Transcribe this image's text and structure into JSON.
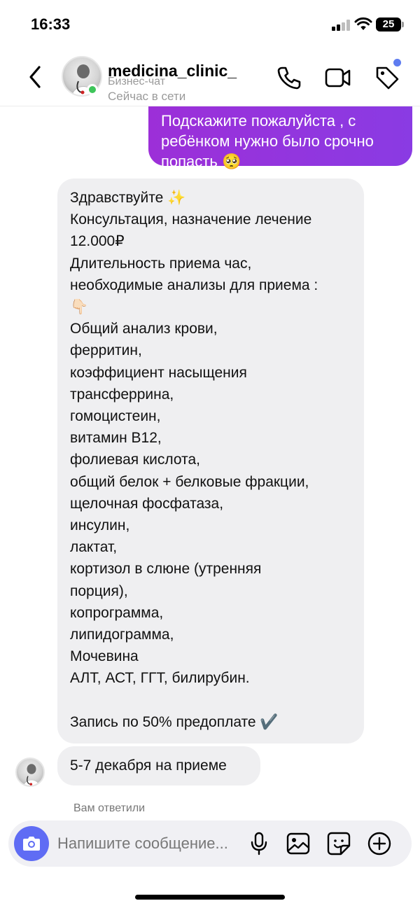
{
  "status_bar": {
    "time": "16:33",
    "battery": "25"
  },
  "header": {
    "name": "medicina_clinic_",
    "subtitle": "Бизнес-чат",
    "status": "Сейчас в сети"
  },
  "messages": {
    "outgoing_partial": "Подскажите пожалуйста , с\nребёнком нужно было срочно\nпопасть 🥺",
    "incoming_main": "Здравствуйте ✨\nКонсультация, назначение лечение\n12.000₽\nДлительность приема час,\nнеобходимые анализы для приема :\n👇🏻\nОбщий анализ крови,\nферритин,\nкоэффициент насыщения\nтрансферрина,\nгомоцистеин,\nвитамин B12,\nфолиевая кислота,\nобщий белок + белковые фракции,\nщелочная фосфатаза,\nинсулин,\nлактат,\nкортизол в слюне (утренняя\nпорция),\nкопрограмма,\nлипидограмма,\nМочевина\nАЛТ, АСТ, ГГТ, билирубин.\n\nЗапись по 50% предоплате ✔️",
    "incoming_short": "5-7 декабря на приеме",
    "replied_note": "Вам ответили"
  },
  "composer": {
    "placeholder": "Напишите сообщение..."
  },
  "colors": {
    "outgoing_bubble": "#9c2fd8",
    "incoming_bubble": "#efeff1",
    "camera_button": "#5f6cf4",
    "online": "#3ec55a",
    "notification_dot": "#5e7cf0"
  },
  "icons": [
    "back-chevron-icon",
    "phone-icon",
    "video-camera-icon",
    "tag-icon",
    "camera-icon",
    "microphone-icon",
    "gallery-icon",
    "sticker-icon",
    "plus-icon"
  ]
}
